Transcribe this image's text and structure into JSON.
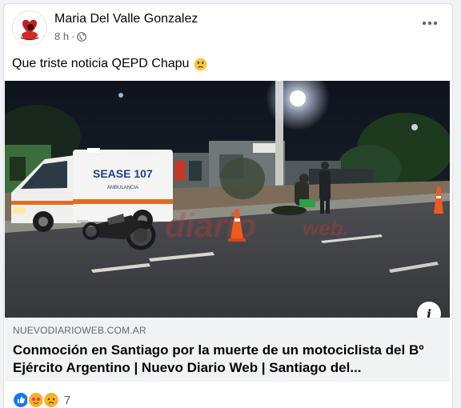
{
  "post": {
    "author": "Maria Del Valle Gonzalez",
    "time": "8 h",
    "separator": "·",
    "text": "Que triste noticia QEPD Chapu",
    "text_emoji": "sad-face-emoji"
  },
  "media": {
    "ambulance_text": "SEASE 107",
    "ambulance_sub": "AMBULANCIA",
    "watermark": "diario web.",
    "info_glyph": "i"
  },
  "link": {
    "domain": "NUEVODIARIOWEB.COM.AR",
    "title": "Conmoción en Santiago por la muerte de un motociclista del Bº Ejército Argentino | Nuevo Diario Web | Santiago del..."
  },
  "reactions": {
    "count": "7",
    "icons": [
      "like-reaction-icon",
      "love-reaction-icon",
      "sad-reaction-icon"
    ]
  },
  "colors": {
    "like": "#1877f2",
    "love": "#f33e58",
    "sad": "#f7b125",
    "secondary_text": "#65676b"
  }
}
